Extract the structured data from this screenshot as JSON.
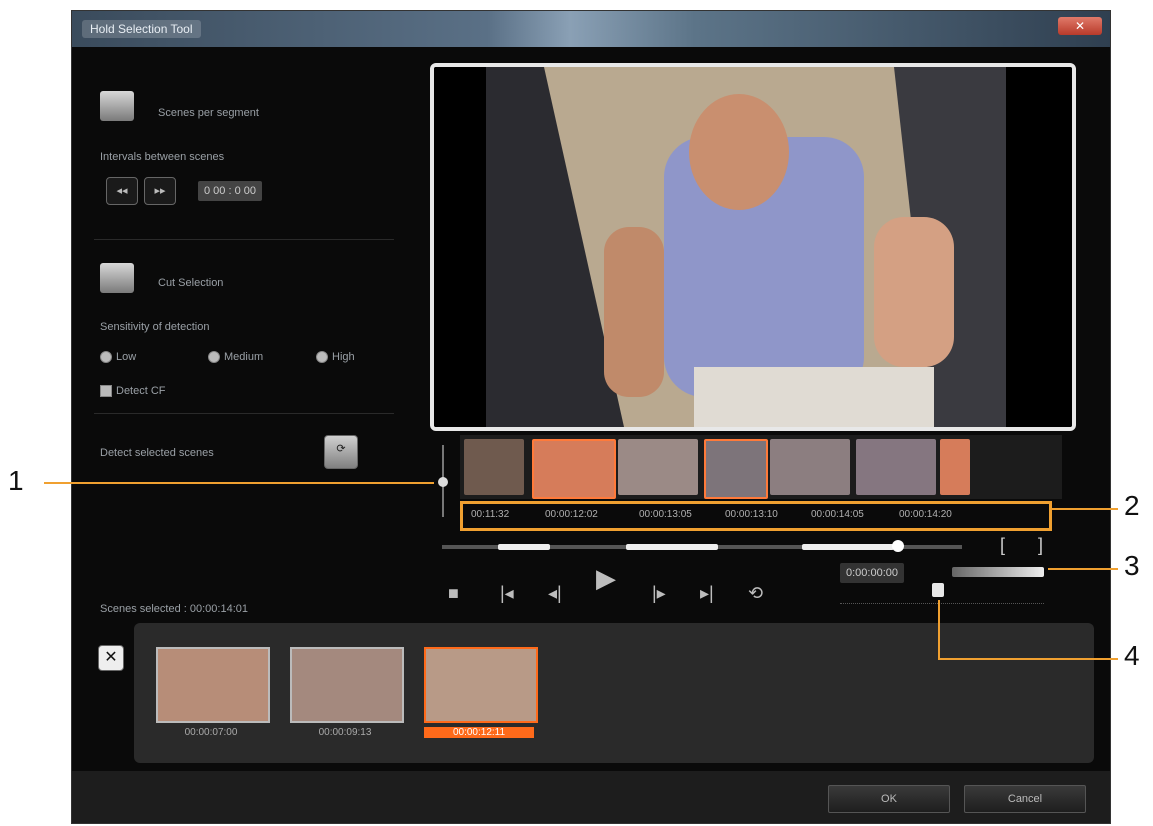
{
  "window": {
    "title": "Hold Selection Tool",
    "close_label": "✕"
  },
  "left_panel": {
    "section1_label": "Scenes per segment",
    "interval_label": "Intervals between scenes",
    "counter_value": "0 00 : 0 00 ",
    "section2_label": "Cut Selection",
    "sensitivity_label": "Sensitivity of detection",
    "radio_low": "Low",
    "radio_medium": "Medium",
    "radio_high": "High",
    "checkbox_label": "Detect CF",
    "detect_label": "Detect selected scenes"
  },
  "filmstrip": {
    "timecodes": [
      "00:11:32",
      "00:00:12:02",
      "00:00:13:05",
      "00:00:13:10",
      "00:00:14:05",
      "00:00:14:20"
    ]
  },
  "right_ctrl": {
    "time_readout": "0:00:00:00",
    "brackets": "[ ]"
  },
  "tray": {
    "label": "Scenes selected : 00:00:14:01",
    "thumbs": [
      {
        "time": "00:00:07:00"
      },
      {
        "time": "00:00:09:13"
      },
      {
        "time": "00:00:12:11"
      }
    ]
  },
  "buttons": {
    "ok": "OK",
    "cancel": "Cancel"
  },
  "callouts": [
    "1",
    "2",
    "3",
    "4"
  ],
  "colors": {
    "accent": "#f0a030",
    "selected_tray": "#ff6a1a"
  }
}
